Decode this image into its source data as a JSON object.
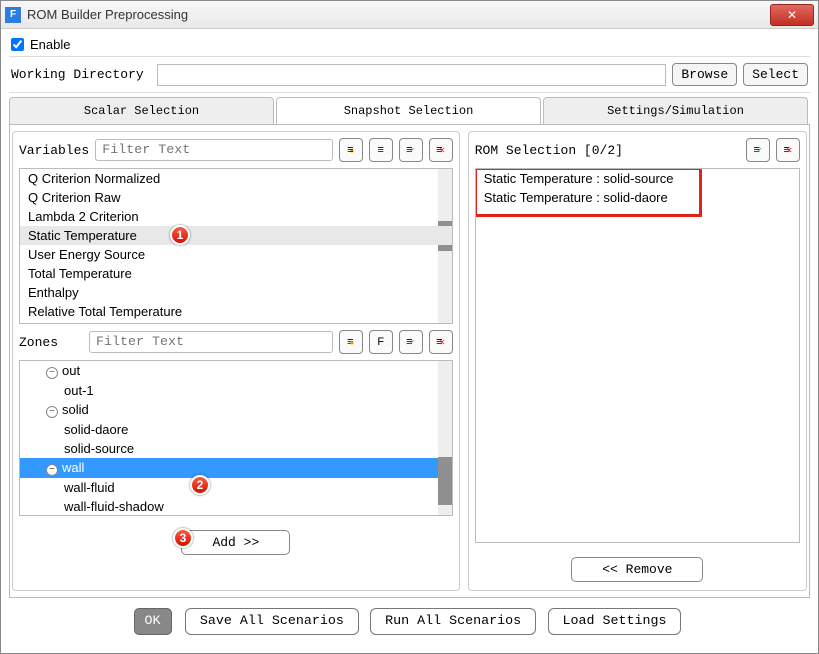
{
  "window": {
    "title": "ROM Builder Preprocessing"
  },
  "enable": {
    "label": "Enable",
    "checked": true
  },
  "working_dir": {
    "label": "Working Directory",
    "value": "",
    "browse": "Browse",
    "select": "Select"
  },
  "tabs": {
    "scalar": "Scalar Selection",
    "snapshot": "Snapshot Selection",
    "settings": "Settings/Simulation"
  },
  "variables": {
    "label": "Variables",
    "filter_placeholder": "Filter Text",
    "items": [
      "Q Criterion Normalized",
      "Q Criterion Raw",
      "Lambda 2 Criterion",
      "Static Temperature",
      "User Energy Source",
      "Total Temperature",
      "Enthalpy",
      "Relative Total Temperature"
    ]
  },
  "zones": {
    "label": "Zones",
    "filter_placeholder": "Filter Text",
    "tree": [
      {
        "label": "out",
        "level": 0,
        "expandable": true
      },
      {
        "label": "out-1",
        "level": 1,
        "expandable": false
      },
      {
        "label": "solid",
        "level": 0,
        "expandable": true
      },
      {
        "label": "solid-daore",
        "level": 1,
        "expandable": false
      },
      {
        "label": "solid-source",
        "level": 1,
        "expandable": false
      },
      {
        "label": "wall",
        "level": 0,
        "expandable": true,
        "selected": true
      },
      {
        "label": "wall-fluid",
        "level": 1,
        "expandable": false
      },
      {
        "label": "wall-fluid-shadow",
        "level": 1,
        "expandable": false
      }
    ]
  },
  "rom": {
    "label": "ROM Selection [0/2]",
    "items": [
      "Static Temperature : solid-source",
      "Static Temperature : solid-daore"
    ]
  },
  "buttons": {
    "add": "Add  >>",
    "remove": "<<  Remove",
    "ok": "OK",
    "save": "Save All Scenarios",
    "run": "Run All Scenarios",
    "load": "Load Settings"
  },
  "callouts": {
    "1": "1",
    "2": "2",
    "3": "3"
  },
  "icons": {
    "close_x": "✕",
    "minus": "−",
    "check": "✓",
    "x": "✕",
    "f": "F",
    "list": "≡"
  }
}
